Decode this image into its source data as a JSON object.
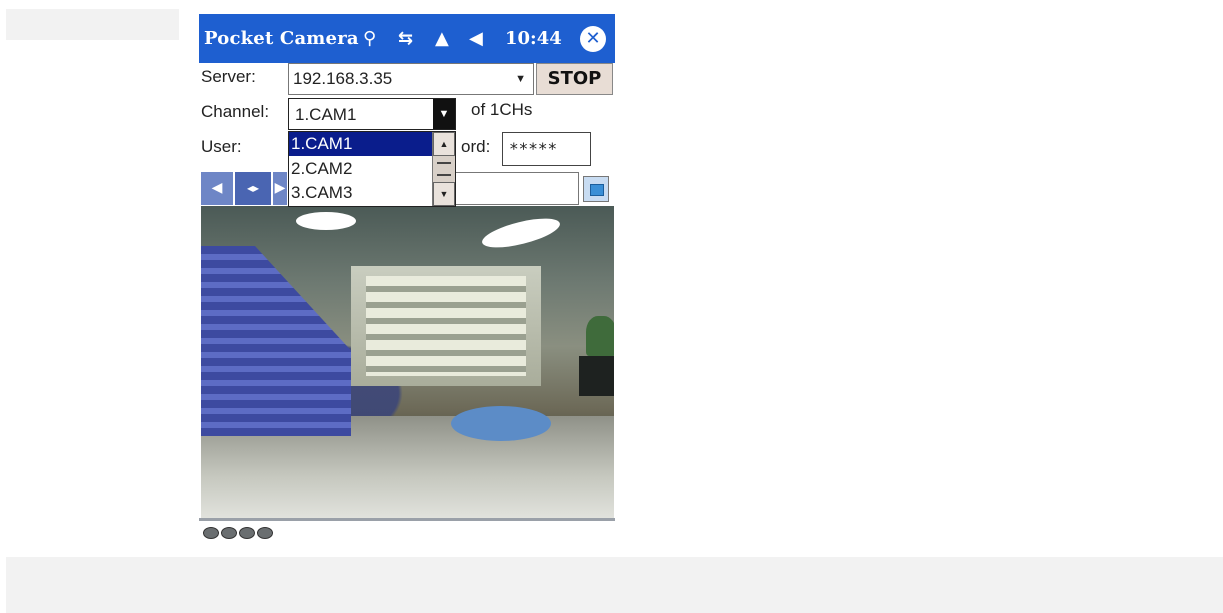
{
  "window": {
    "title": "Pocket Camera",
    "clock": "10:44",
    "icons": [
      "antenna-icon",
      "sync-icon",
      "signal-icon",
      "volume-icon",
      "close-icon"
    ]
  },
  "form": {
    "server_label": "Server:",
    "server_value": "192.168.3.35",
    "stop_label": "STOP",
    "channel_label": "Channel:",
    "channel_value": "1.CAM1",
    "channel_count": "of 1CHs",
    "user_label": "User:",
    "password_label_partial": "ord:",
    "password_value": "*****"
  },
  "channel_dropdown": {
    "options": [
      "1.CAM1",
      "2.CAM2",
      "3.CAM3"
    ],
    "selected_index": 0
  },
  "toolbar": {
    "center_button_label": "◂▸"
  },
  "status": {
    "indicator_count": 4
  },
  "colors": {
    "titlebar": "#1e5fd0",
    "selection": "#0a1d8c",
    "button_face": "#e8ddd5"
  }
}
